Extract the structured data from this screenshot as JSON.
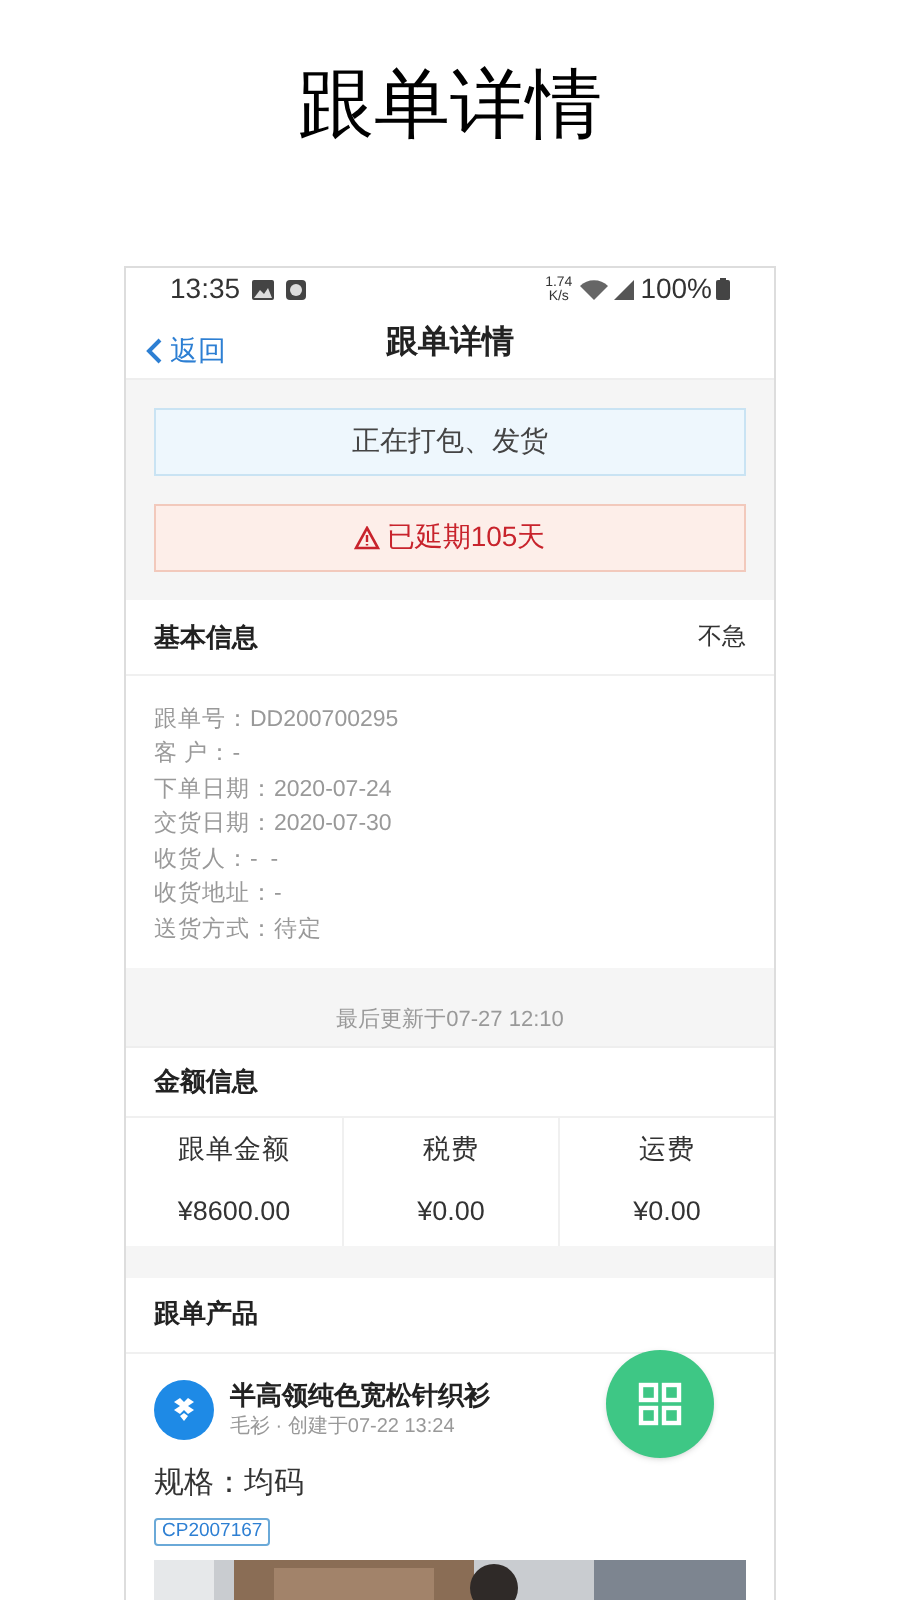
{
  "headline": "跟单详情",
  "status_bar": {
    "time": "13:35",
    "speed": [
      "1.74",
      "K/s"
    ],
    "battery": "100%"
  },
  "nav": {
    "back": "返回",
    "title": "跟单详情"
  },
  "banners": [
    {
      "kind": "status",
      "text": "正在打包、发货"
    },
    {
      "kind": "warning",
      "text": "已延期105天"
    }
  ],
  "basic_info": {
    "title": "基本信息",
    "urgency": "不急",
    "fields": [
      "跟单号：DD200700295",
      "客 户：-",
      "下单日期：2020-07-24",
      "交货日期：2020-07-30",
      "收货人：-  -",
      "收货地址：-",
      "送货方式：待定"
    ]
  },
  "last_updated": "最后更新于07-27 12:10",
  "amounts": {
    "title": "金额信息",
    "items": [
      {
        "label": "跟单金额",
        "value": "¥8600.00"
      },
      {
        "label": "税费",
        "value": "¥0.00"
      },
      {
        "label": "运费",
        "value": "¥0.00"
      }
    ]
  },
  "products": {
    "title": "跟单产品",
    "items": [
      {
        "name": "半高领纯色宽松针织衫",
        "meta": "毛衫 · 创建于07-22 13:24",
        "spec": "规格：均码",
        "code": "CP2007167"
      }
    ]
  }
}
